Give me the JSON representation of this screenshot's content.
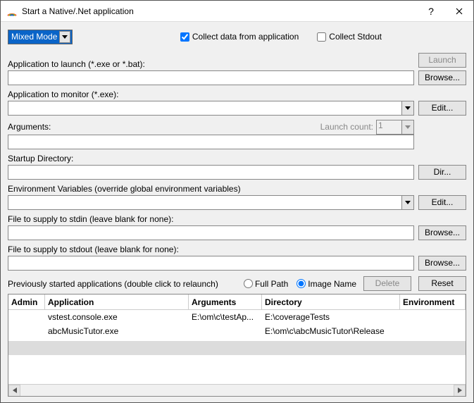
{
  "window": {
    "title": "Start a Native/.Net application"
  },
  "mode": {
    "value": "Mixed Mode"
  },
  "checkboxes": {
    "collect_data": {
      "label": "Collect data from application",
      "checked": true
    },
    "collect_stdout": {
      "label": "Collect Stdout",
      "checked": false
    }
  },
  "buttons": {
    "launch": "Launch",
    "browse": "Browse...",
    "edit": "Edit...",
    "dir": "Dir...",
    "delete": "Delete",
    "reset": "Reset"
  },
  "fields": {
    "app_launch": {
      "label": "Application to launch (*.exe or *.bat):",
      "value": ""
    },
    "app_monitor": {
      "label": "Application to monitor (*.exe):",
      "value": ""
    },
    "arguments": {
      "label": "Arguments:",
      "value": ""
    },
    "launch_count": {
      "label": "Launch count:",
      "value": "1"
    },
    "startup_dir": {
      "label": "Startup Directory:",
      "value": ""
    },
    "env_vars": {
      "label": "Environment Variables (override global environment variables)",
      "value": ""
    },
    "stdin": {
      "label": "File to supply to stdin (leave blank for none):",
      "value": ""
    },
    "stdout": {
      "label": "File to supply to stdout (leave blank for none):",
      "value": ""
    }
  },
  "previous": {
    "label": "Previously started applications (double click to relaunch)",
    "radio": {
      "full_path": "Full Path",
      "image_name": "Image Name",
      "selected": "image_name"
    }
  },
  "table": {
    "headers": {
      "admin": "Admin",
      "app": "Application",
      "args": "Arguments",
      "dir": "Directory",
      "env": "Environment"
    },
    "rows": [
      {
        "admin": "",
        "app": "vstest.console.exe",
        "args": "E:\\om\\c\\testAp...",
        "dir": "E:\\coverageTests",
        "env": ""
      },
      {
        "admin": "",
        "app": "abcMusicTutor.exe",
        "args": "",
        "dir": "E:\\om\\c\\abcMusicTutor\\Release",
        "env": ""
      }
    ]
  }
}
